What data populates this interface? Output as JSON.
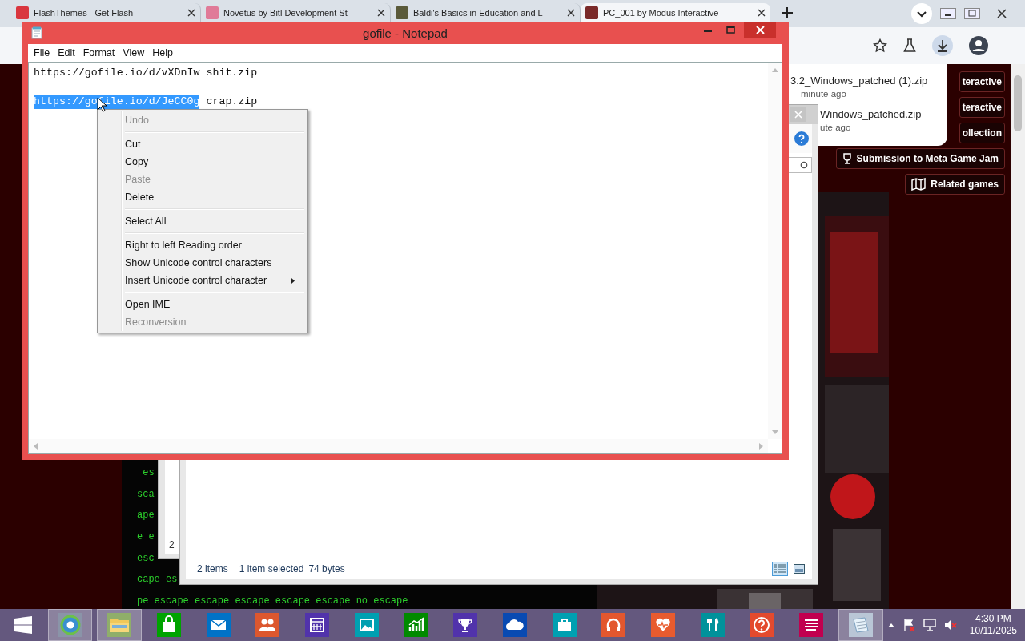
{
  "browser": {
    "tabs": [
      {
        "title": "FlashThemes - Get Flash",
        "color": "#d9363e",
        "selected": false
      },
      {
        "title": "Novetus by Bitl Development St",
        "color": "#e07a98",
        "selected": false
      },
      {
        "title": "Baldi's Basics in Education and L",
        "color": "#5a5a3a",
        "selected": false
      },
      {
        "title": "PC_001 by Modus Interactive",
        "color": "#7a2a2a",
        "selected": true
      }
    ]
  },
  "page": {
    "terminal_lines": [
      " es",
      "sca",
      "ape",
      "e e",
      "esc",
      "cape es",
      "pe escape escape escape escape escape no escape"
    ],
    "buttons": [
      {
        "label": "teractive",
        "kind": "plain"
      },
      {
        "label": "teractive",
        "kind": "plain"
      },
      {
        "label": "ollection",
        "kind": "plain"
      },
      {
        "label": "Submission to Meta Game Jam",
        "kind": "jam"
      },
      {
        "label": "Related games",
        "kind": "map"
      }
    ]
  },
  "downloads": [
    {
      "name": "3.2_Windows_patched (1).zip",
      "time": "minute ago"
    },
    {
      "name": "Windows_patched.zip",
      "time": "ute ago"
    }
  ],
  "back_window": {
    "text": "2"
  },
  "explorer": {
    "status": [
      "2 items",
      "1 item selected",
      "74 bytes"
    ]
  },
  "notepad": {
    "title": "gofile - Notepad",
    "menu": [
      "File",
      "Edit",
      "Format",
      "View",
      "Help"
    ],
    "lines": [
      {
        "caret": false,
        "segments": [
          {
            "text": "https://gofile.io/d/vXDnIw shit.zip",
            "selected": false
          }
        ]
      },
      {
        "caret": true
      },
      {
        "caret": false,
        "segments": [
          {
            "text": "https://gofile.io/d/JeCC0g",
            "selected": true
          },
          {
            "text": " crap.zip",
            "selected": false
          }
        ]
      }
    ],
    "context_menu": [
      {
        "kind": "item",
        "label": "Undo",
        "disabled": true,
        "submenu": false
      },
      {
        "kind": "separator"
      },
      {
        "kind": "item",
        "label": "Cut",
        "disabled": false,
        "submenu": false
      },
      {
        "kind": "item",
        "label": "Copy",
        "disabled": false,
        "submenu": false
      },
      {
        "kind": "item",
        "label": "Paste",
        "disabled": true,
        "submenu": false
      },
      {
        "kind": "item",
        "label": "Delete",
        "disabled": false,
        "submenu": false
      },
      {
        "kind": "separator"
      },
      {
        "kind": "item",
        "label": "Select All",
        "disabled": false,
        "submenu": false
      },
      {
        "kind": "separator"
      },
      {
        "kind": "item",
        "label": "Right to left Reading order",
        "disabled": false,
        "submenu": false
      },
      {
        "kind": "item",
        "label": "Show Unicode control characters",
        "disabled": false,
        "submenu": false
      },
      {
        "kind": "item",
        "label": "Insert Unicode control character",
        "disabled": false,
        "submenu": true
      },
      {
        "kind": "separator"
      },
      {
        "kind": "item",
        "label": "Open IME",
        "disabled": false,
        "submenu": false
      },
      {
        "kind": "item",
        "label": "Reconversion",
        "disabled": true,
        "submenu": false
      }
    ]
  },
  "taskbar": {
    "apps": [
      {
        "kind": "browser",
        "color": "#8a94a8",
        "active": true
      },
      {
        "kind": "folder",
        "color": "#8fae6a",
        "active": true
      },
      {
        "kind": "store",
        "color": "#00a300",
        "active": false
      },
      {
        "kind": "mail",
        "color": "#0072c6",
        "active": false
      },
      {
        "kind": "people",
        "color": "#dc572e",
        "active": false
      },
      {
        "kind": "calendar",
        "color": "#5133ab",
        "active": false
      },
      {
        "kind": "photos",
        "color": "#00a0b1",
        "active": false
      },
      {
        "kind": "finance",
        "color": "#008a00",
        "active": false
      },
      {
        "kind": "trophy",
        "color": "#5133ab",
        "active": false
      },
      {
        "kind": "cloud",
        "color": "#094ab2",
        "active": false
      },
      {
        "kind": "suitcase",
        "color": "#00a0b1",
        "active": false
      },
      {
        "kind": "headphones",
        "color": "#e3572e",
        "active": false
      },
      {
        "kind": "heart",
        "color": "#e85b2e",
        "active": false
      },
      {
        "kind": "food",
        "color": "#00929b",
        "active": false
      },
      {
        "kind": "help",
        "color": "#e34a2e",
        "active": false
      },
      {
        "kind": "list",
        "color": "#c1004f",
        "active": false
      },
      {
        "kind": "notepad",
        "color": "#b9c6d6",
        "active": true
      }
    ],
    "clock": {
      "time": "4:30 PM",
      "date": "10/11/2025"
    }
  }
}
